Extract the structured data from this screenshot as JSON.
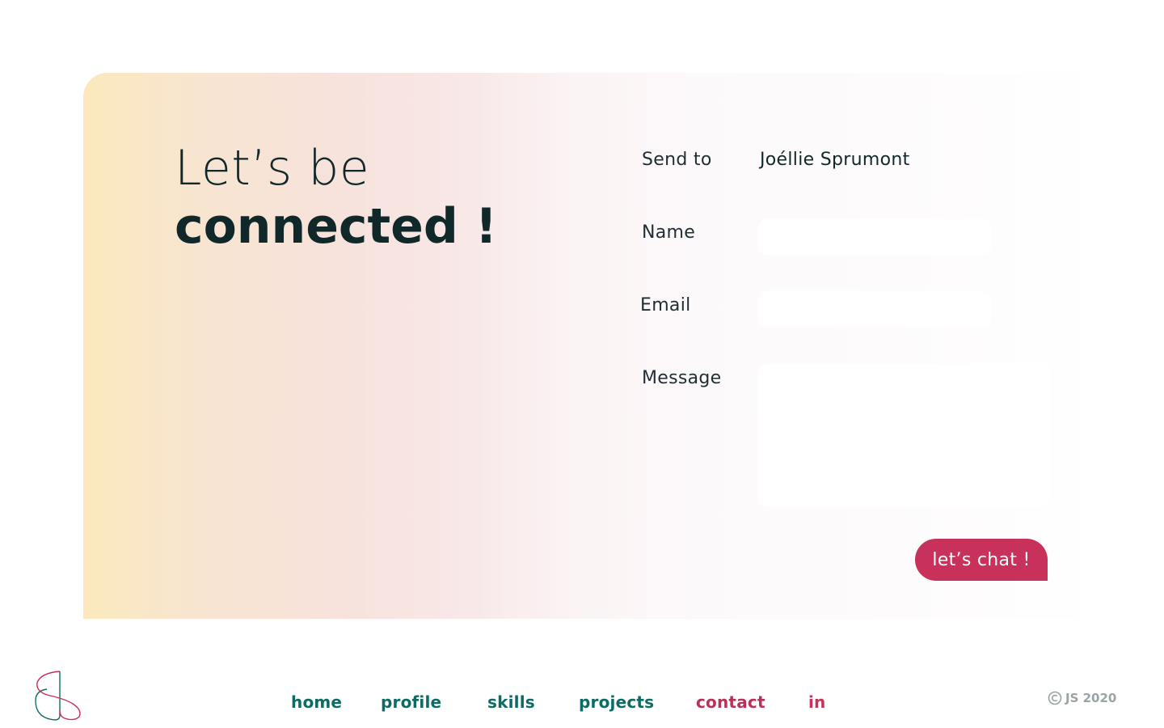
{
  "headline": {
    "line1": "Let’s be",
    "line2": "connected !"
  },
  "form": {
    "send_to_label": "Send to",
    "recipient": "Joéllie Sprumont",
    "name_label": "Name",
    "name_value": "",
    "email_label": "Email",
    "email_value": "",
    "message_label": "Message",
    "message_value": "",
    "submit_label": "let’s chat !"
  },
  "nav": {
    "items": [
      {
        "label": "home"
      },
      {
        "label": "profile"
      },
      {
        "label": "skills"
      },
      {
        "label": "projects"
      },
      {
        "label": "contact"
      },
      {
        "label": "in"
      }
    ],
    "active": "contact"
  },
  "footer": {
    "copyright": "JS 2020"
  },
  "colors": {
    "accent": "#c8315a",
    "nav": "#0d6b63",
    "text": "#10282a",
    "muted": "#9aa3a5"
  },
  "icons": {
    "logo": "js-monogram-logo",
    "copyright": "copyright-icon"
  }
}
